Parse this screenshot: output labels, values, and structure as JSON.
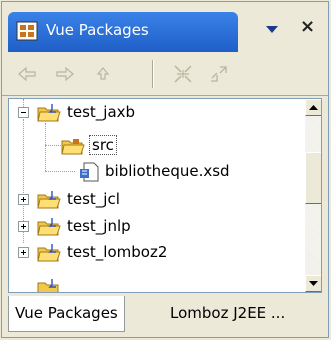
{
  "view": {
    "title": "Vue Packages",
    "icon": "package-explorer-icon",
    "menu_icon": "chevron-down-icon",
    "close_label": "×"
  },
  "toolbar": {
    "buttons": [
      {
        "name": "back-button",
        "icon": "arrow-left-icon"
      },
      {
        "name": "forward-button",
        "icon": "arrow-right-icon"
      },
      {
        "name": "up-button",
        "icon": "arrow-up-icon"
      },
      {
        "name": "collapse-all-button",
        "icon": "collapse-all-icon"
      },
      {
        "name": "link-with-editor-button",
        "icon": "link-editor-icon"
      }
    ]
  },
  "tree": {
    "items": [
      {
        "label": "test_jaxb",
        "type": "project",
        "expanded": true
      },
      {
        "label": "src",
        "type": "source-folder",
        "selected": true
      },
      {
        "label": "bibliotheque.xsd",
        "type": "file"
      },
      {
        "label": "test_jcl",
        "type": "project",
        "expanded": false
      },
      {
        "label": "test_jnlp",
        "type": "project",
        "expanded": false
      },
      {
        "label": "test_lomboz2",
        "type": "project",
        "expanded": false
      }
    ]
  },
  "bottom_tabs": [
    {
      "label": "Vue Packages",
      "active": true
    },
    {
      "label": "Lomboz J2EE ...",
      "active": false
    }
  ],
  "colors": {
    "title_gradient_top": "#3a82e8",
    "title_gradient_bottom": "#1f5fc8",
    "chrome": "#ece9d8",
    "border": "#7f9db9"
  }
}
